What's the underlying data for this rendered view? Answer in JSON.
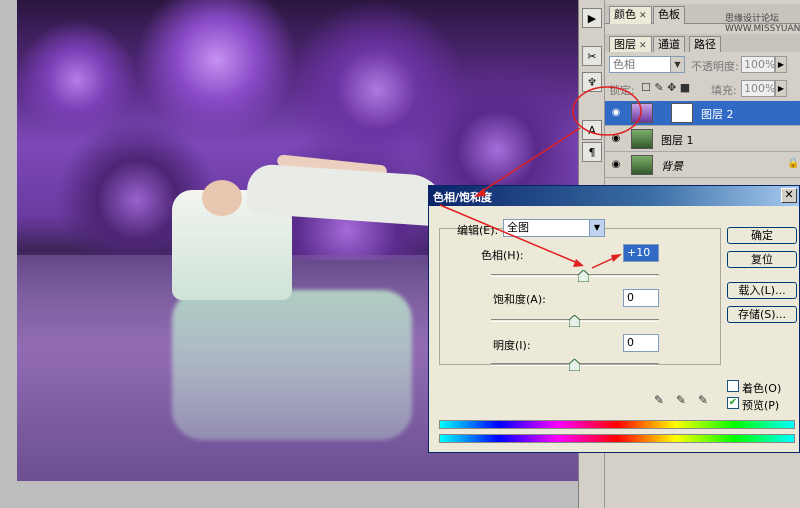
{
  "panels": {
    "color_tab": "颜色",
    "swatch_tab": "色板",
    "watermark": "思缘设计论坛  WWW.MISSYUAN.COM",
    "tabs": [
      "图层",
      "通道",
      "路径"
    ],
    "blend_mode": "色相",
    "opacity_label": "不透明度:",
    "opacity_value": "100%",
    "lock_label": "锁定:",
    "fill_label": "填充:",
    "fill_value": "100%",
    "layers": [
      {
        "name": "图层 2",
        "selected": true
      },
      {
        "name": "图层 1",
        "selected": false
      },
      {
        "name": "背景",
        "selected": false
      }
    ]
  },
  "dialog": {
    "title": "色相/饱和度",
    "edit_label": "编辑(E):",
    "edit_value": "全图",
    "hue_label": "色相(H):",
    "hue_value": "+10",
    "saturation_label": "饱和度(A):",
    "saturation_value": "0",
    "lightness_label": "明度(I):",
    "lightness_value": "0",
    "buttons": {
      "ok": "确定",
      "reset": "复位",
      "load": "载入(L)...",
      "save": "存储(S)..."
    },
    "colorize_label": "着色(O)",
    "colorize_checked": false,
    "preview_label": "预览(P)",
    "preview_checked": true
  },
  "colors": {
    "selection": "#316ac5",
    "dialog_title": "#0a246a",
    "annotation": "#e02020"
  }
}
